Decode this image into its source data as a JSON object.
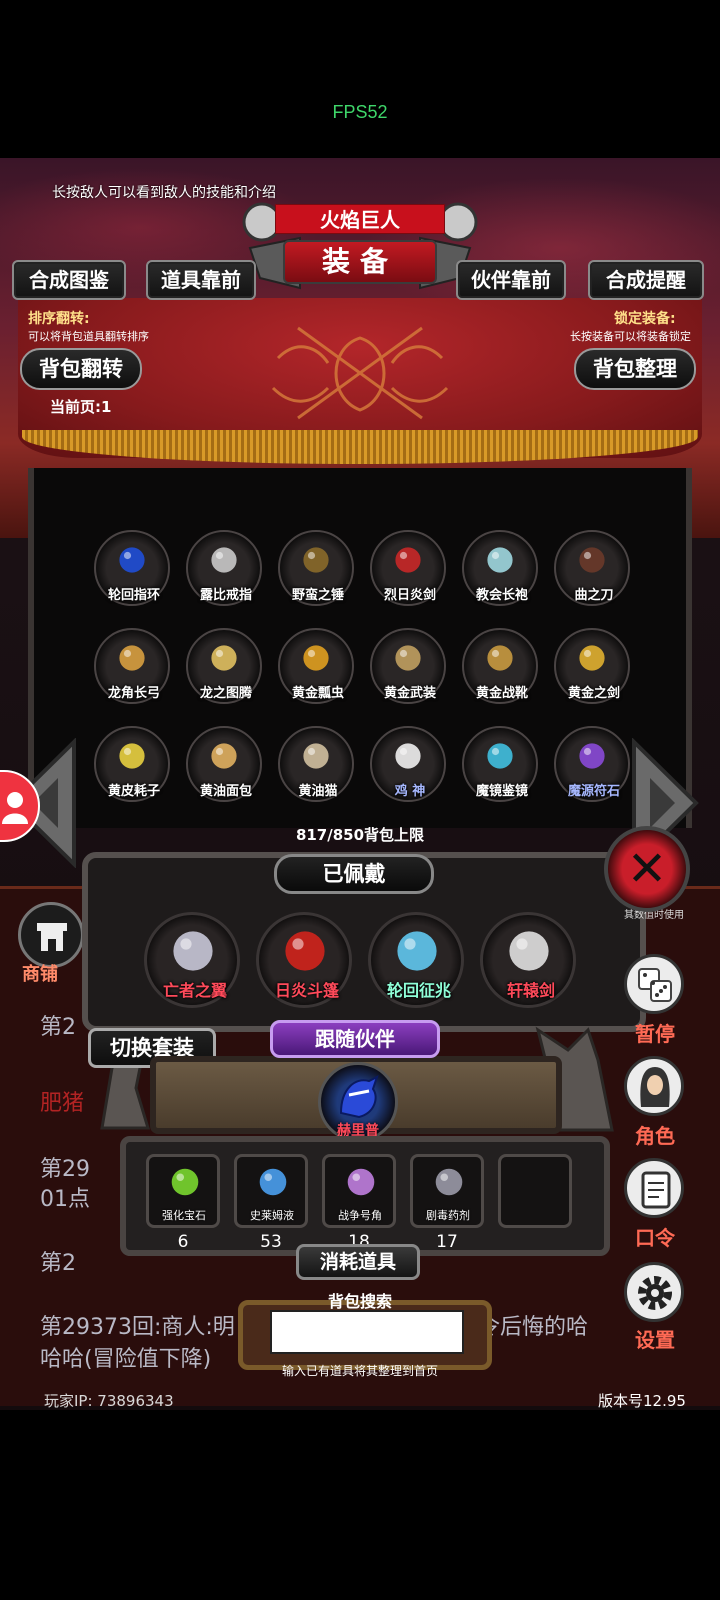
{
  "status": {
    "fps": "FPS52"
  },
  "tip": "长按敌人可以看到敌人的技能和介绍",
  "header": {
    "boss_name": "火焰巨人",
    "title": "装备"
  },
  "top_buttons": {
    "atlas": "合成图鉴",
    "items_front": "道具靠前",
    "partner_front": "伙伴靠前",
    "synth_remind": "合成提醒"
  },
  "banner": {
    "sort_title": "排序翻转:",
    "sort_hint": "可以将背包道具翻转排序",
    "lock_title": "锁定装备:",
    "lock_hint": "长按装备可以将装备锁定",
    "flip_button": "背包翻转",
    "sort_button": "背包整理",
    "page_indicator": "当前页:1"
  },
  "inventory": [
    {
      "label": "轮回指环",
      "icon": "ring-blue-gem-icon",
      "color": "#1f4fd8"
    },
    {
      "label": "露比戒指",
      "icon": "silver-ring-icon",
      "color": "#c9c9c9"
    },
    {
      "label": "野蛮之锤",
      "icon": "club-icon",
      "color": "#8a6a2a"
    },
    {
      "label": "烈日炎剑",
      "icon": "flame-sword-icon",
      "color": "#c82828"
    },
    {
      "label": "教会长袍",
      "icon": "robe-icon",
      "color": "#9fd8e0"
    },
    {
      "label": "曲之刀",
      "icon": "curved-blade-icon",
      "color": "#6a3a2a"
    },
    {
      "label": "龙角长弓",
      "icon": "bow-icon",
      "color": "#d8a040"
    },
    {
      "label": "龙之图腾",
      "icon": "totem-icon",
      "color": "#e0c060"
    },
    {
      "label": "黄金瓢虫",
      "icon": "beetle-icon",
      "color": "#e0a020"
    },
    {
      "label": "黄金武装",
      "icon": "armor-icon",
      "color": "#c0a060"
    },
    {
      "label": "黄金战靴",
      "icon": "boots-icon",
      "color": "#c89a40"
    },
    {
      "label": "黄金之剑",
      "icon": "gold-sword-icon",
      "color": "#e0b030"
    },
    {
      "label": "黄皮耗子",
      "icon": "rat-icon",
      "color": "#e8d040"
    },
    {
      "label": "黄油面包",
      "icon": "bread-icon",
      "color": "#e0b060"
    },
    {
      "label": "黄油猫",
      "icon": "cat-icon",
      "color": "#d0c0a0"
    },
    {
      "label": "鸡 神",
      "icon": "chicken-icon",
      "color": "#f0f0f0",
      "label_color": "blue"
    },
    {
      "label": "魔镜鉴镜",
      "icon": "mirror-icon",
      "color": "#40c0e0"
    },
    {
      "label": "魔源符石",
      "icon": "rune-stone-icon",
      "color": "#8a4ad8",
      "label_color": "blue"
    }
  ],
  "capacity": "817/850背包上限",
  "worn": {
    "title": "已佩戴",
    "items": [
      {
        "label": "亡者之翼",
        "icon": "wings-icon",
        "color": "#c8c8d8"
      },
      {
        "label": "日炎斗篷",
        "icon": "cloak-icon",
        "color": "#d0241c"
      },
      {
        "label": "轮回征兆",
        "icon": "staff-icon",
        "color": "#60c8f0",
        "label_color": "cyan"
      },
      {
        "label": "轩辕剑",
        "icon": "sword-icon",
        "color": "#e0e0e0"
      }
    ]
  },
  "set_switch": "切换套装",
  "partner": {
    "title": "跟随伙伴",
    "name": "赫里普",
    "icon": "dragon-partner-icon",
    "color": "#2a4ad8"
  },
  "consumables": {
    "title": "消耗道具",
    "items": [
      {
        "label": "强化宝石",
        "count": "6",
        "icon": "gem-icon",
        "color": "#7ad830"
      },
      {
        "label": "史莱姆液",
        "count": "53",
        "icon": "potion-icon",
        "color": "#4aa0f0"
      },
      {
        "label": "战争号角",
        "count": "18",
        "icon": "horn-icon",
        "color": "#c080e0"
      },
      {
        "label": "剧毒药剂",
        "count": "17",
        "icon": "poison-icon",
        "color": "#9a9aa8"
      }
    ]
  },
  "search": {
    "title": "背包搜索",
    "value": "",
    "hint": "输入已有道具将其整理到首页"
  },
  "log": {
    "line1": "第2",
    "line2": "肥猪",
    "line3": "第29",
    "line4": "01点",
    "line5": "第2",
    "line6": "第29373回:商人:明",
    "line6b": "令后悔的哈",
    "line7": "哈哈(冒险值下降)"
  },
  "side": {
    "shop": "商铺",
    "auto_pct": "其数值时使用",
    "pause": "暂停",
    "role": "角色",
    "password": "口令",
    "settings": "设置"
  },
  "footer": {
    "player_ip": "玩家IP:  73896343",
    "version": "版本号12.95"
  }
}
